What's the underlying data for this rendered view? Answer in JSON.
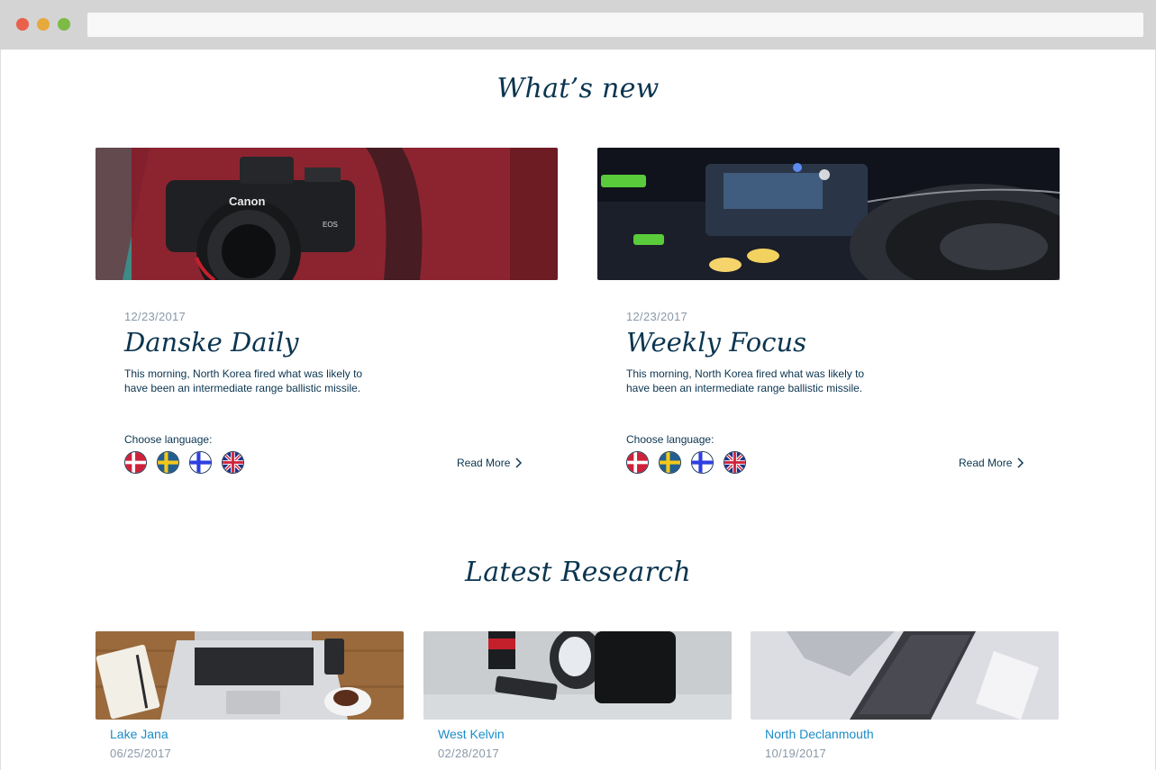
{
  "browser": {
    "address": ""
  },
  "sections": {
    "whats_new_title": "What’s new",
    "latest_research_title": "Latest Research"
  },
  "news": [
    {
      "date": "12/23/2017",
      "title": "Danske Daily",
      "description": "This morning, North Korea fired what was likely to have been an intermediate range ballistic missile.",
      "language_label": "Choose language:",
      "languages": [
        "danish-flag-icon",
        "swedish-flag-icon",
        "finnish-flag-icon",
        "uk-flag-icon"
      ],
      "read_more": "Read More",
      "image": "canon-camera-photo"
    },
    {
      "date": "12/23/2017",
      "title": "Weekly Focus",
      "description": "This morning, North Korea fired what was likely to have been an intermediate range ballistic missile.",
      "language_label": "Choose language:",
      "languages": [
        "danish-flag-icon",
        "swedish-flag-icon",
        "finnish-flag-icon",
        "uk-flag-icon"
      ],
      "read_more": "Read More",
      "image": "dj-turntable-photo"
    }
  ],
  "research": [
    {
      "name": "Lake Jana",
      "date": "06/25/2017",
      "image": "laptop-desk-photo"
    },
    {
      "name": "West Kelvin",
      "date": "02/28/2017",
      "image": "camera-sdcard-photo"
    },
    {
      "name": "North Declanmouth",
      "date": "10/19/2017",
      "image": "keyboard-photo"
    }
  ],
  "colors": {
    "heading": "#0b3550",
    "date": "#8a98a8",
    "research_link": "#1b8cc7",
    "chrome": "#d4d4d4"
  }
}
